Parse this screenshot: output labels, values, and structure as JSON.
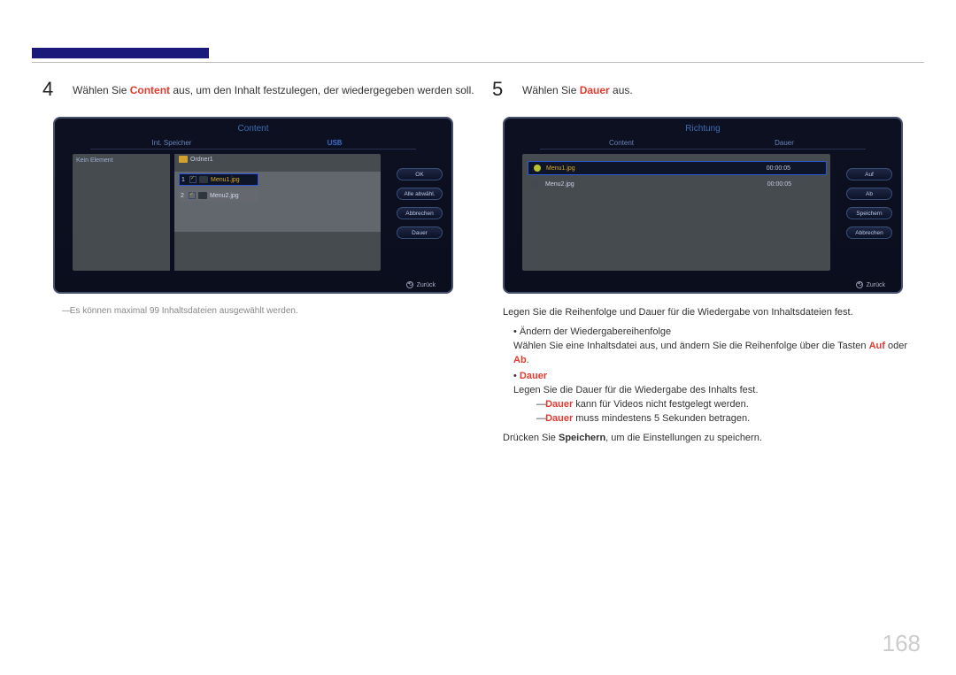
{
  "page_number": "168",
  "step4": {
    "num": "4",
    "pre": "Wählen Sie ",
    "kw": "Content",
    "post": " aus, um den Inhalt festzulegen, der wiedergegeben werden soll."
  },
  "step5": {
    "num": "5",
    "pre": "Wählen Sie ",
    "kw": "Dauer",
    "post": " aus."
  },
  "tv1": {
    "title": "Content",
    "tab1": "Int. Speicher",
    "tab2": "USB",
    "leftlabel": "Kein Element",
    "folder": "Ordner1",
    "row1_num": "1",
    "row1_label": "Menu1.jpg",
    "row2_num": "2",
    "row2_label": "Menu2.jpg",
    "b1": "OK",
    "b2": "Alle abwähl.",
    "b3": "Abbrechen",
    "b4": "Dauer",
    "back": "Zurück"
  },
  "tv2": {
    "title": "Richtung",
    "tab1": "Content",
    "tab2": "Dauer",
    "row1_label": "Menu1.jpg",
    "row1_dur": "00:00:05",
    "row2_label": "Menu2.jpg",
    "row2_dur": "00:00:05",
    "b1": "Auf",
    "b2": "Ab",
    "b3": "Speichern",
    "b4": "Abbrechen",
    "back": "Zurück"
  },
  "note_left": "Es können maximal 99 Inhaltsdateien ausgewählt werden.",
  "right_explain": {
    "intro": "Legen Sie die Reihenfolge und Dauer für die Wiedergabe von Inhaltsdateien fest.",
    "item1_title": "Ändern der Wiedergabereihenfolge",
    "item1_body_pre": "Wählen Sie eine Inhaltsdatei aus, und ändern Sie die Reihenfolge über die Tasten ",
    "item1_body_k1": "Auf",
    "item1_body_mid": " oder ",
    "item1_body_k2": "Ab",
    "item2_title": "Dauer",
    "item2_body": "Legen Sie die Dauer für die Wiedergabe des Inhalts fest.",
    "sub1_k": "Dauer",
    "sub1_rest": " kann für Videos nicht festgelegt werden.",
    "sub2_k": "Dauer",
    "sub2_rest": " muss mindestens 5 Sekunden betragen.",
    "save_pre": "Drücken Sie ",
    "save_k": "Speichern",
    "save_post": ", um die Einstellungen zu speichern."
  }
}
